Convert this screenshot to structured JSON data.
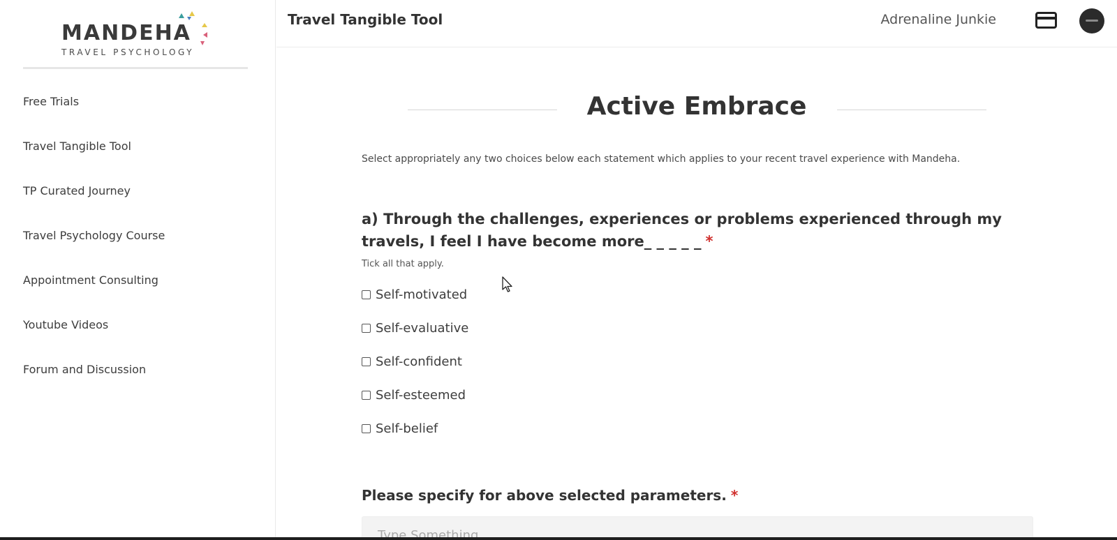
{
  "brand": {
    "name": "MANDEHA",
    "tagline": "TRAVEL PSYCHOLOGY"
  },
  "sidebar": {
    "items": [
      {
        "label": "Free Trials"
      },
      {
        "label": "Travel Tangible Tool"
      },
      {
        "label": "TP Curated Journey"
      },
      {
        "label": "Travel Psychology Course"
      },
      {
        "label": "Appointment Consulting"
      },
      {
        "label": "Youtube Videos"
      },
      {
        "label": "Forum and Discussion"
      }
    ]
  },
  "header": {
    "title": "Travel Tangible Tool",
    "user_label": "Adrenaline Junkie",
    "card_icon": "credit-card-icon",
    "avatar_icon": "avatar"
  },
  "main": {
    "title": "Active Embrace",
    "instructions": "Select appropriately any two choices below each statement which applies to your recent travel experience with Mandeha.",
    "question1": {
      "text": "a) Through the challenges, experiences or problems experienced through my travels, I feel I have become more_ _ _ _ _",
      "required_mark": "*",
      "hint": "Tick all that apply.",
      "options": [
        {
          "label": "Self-motivated",
          "checked": false
        },
        {
          "label": "Self-evaluative",
          "checked": false
        },
        {
          "label": "Self-confident",
          "checked": false
        },
        {
          "label": "Self-esteemed",
          "checked": false
        },
        {
          "label": "Self-belief",
          "checked": false
        }
      ]
    },
    "question2": {
      "text": "Please specify for above selected parameters.",
      "required_mark": "*",
      "placeholder": "Type Something"
    }
  },
  "colors": {
    "required": "#d0302e",
    "logo_teal": "#3a9e9e",
    "logo_yellow": "#e6c84a",
    "logo_pink": "#d9607a",
    "logo_blue": "#4a7fc0"
  }
}
